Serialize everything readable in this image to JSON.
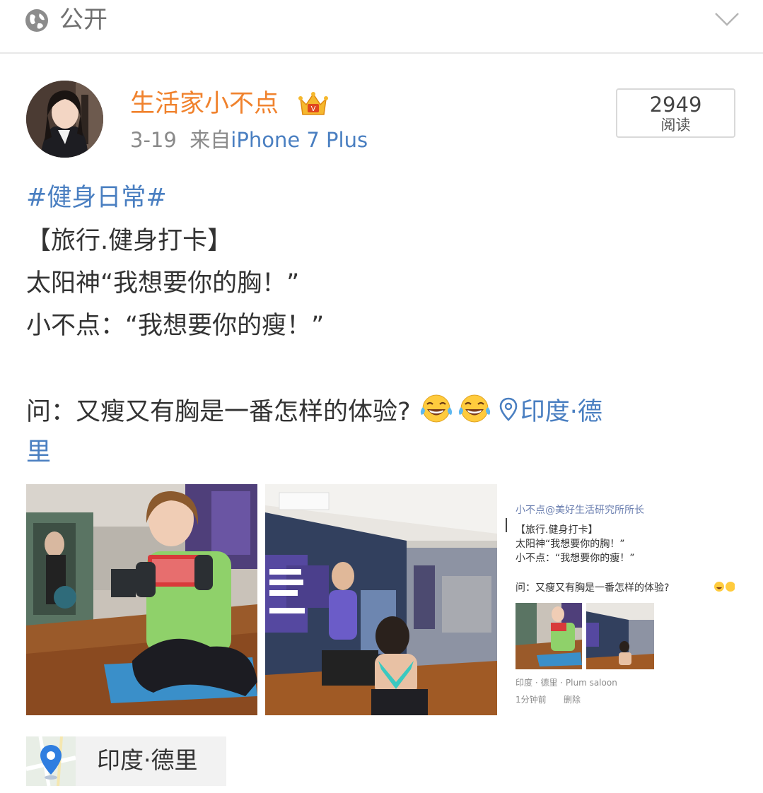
{
  "visibility": {
    "icon": "globe-icon",
    "label": "公开"
  },
  "post": {
    "author": {
      "name": "生活家小不点",
      "badge": "vip-crown-icon"
    },
    "meta": {
      "date": "3-19",
      "source_prefix": "来自",
      "device": "iPhone 7 Plus"
    },
    "reads": {
      "count": "2949",
      "label": "阅读"
    },
    "text": {
      "hashtag": "#健身日常#",
      "line1": "【旅行.健身打卡】",
      "line2": "太阳神“我想要你的胸！”",
      "line3": "小不点：“我想要你的瘦！”",
      "line4": "问：又瘦又有胸是一番怎样的体验?",
      "location_inline_1": "印度·德",
      "location_inline_2": "里"
    },
    "photos": [
      {
        "alt": "gym-selfie-photo"
      },
      {
        "alt": "gym-mirror-photo"
      },
      {
        "alt": "post-screenshot-photo",
        "embedded": {
          "header": "小不点@美好生活研究所所长",
          "line1": "【旅行.健身打卡】",
          "line2": "太阳神“我想要你的胸！”",
          "line3": "小不点：“我想要你的瘦！”",
          "line4": "问：又瘦又有胸是一番怎样的体验?",
          "location": "印度 · 德里 · Plum saloon",
          "time": "1分钟前",
          "delete": "删除"
        }
      }
    ],
    "location_chip": {
      "icon": "map-pin-icon",
      "label": "印度·德里"
    }
  },
  "colors": {
    "link": "#4a7fc1",
    "username": "#f0822d",
    "text": "#333333",
    "meta": "#8a8a8a"
  }
}
